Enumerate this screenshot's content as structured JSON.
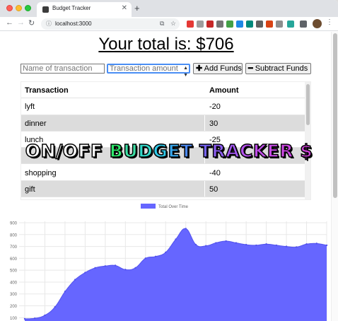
{
  "browser": {
    "tab_title": "Budget Tracker",
    "tab_close": "✕",
    "new_tab": "+",
    "url": "localhost:3000",
    "back_icon": "←",
    "forward_icon": "→",
    "reload_icon": "↻",
    "menu_icon": "⋮"
  },
  "page": {
    "total_text": "Your total is: $706",
    "name_placeholder": "Name of transaction",
    "amount_placeholder": "Transaction amount",
    "add_label": "Add Funds",
    "subtract_label": "Subtract Funds",
    "overlay_title": "ON/OFF BUDGET TRACKER $"
  },
  "table": {
    "headers": [
      "Transaction",
      "Amount"
    ],
    "rows": [
      {
        "name": "lyft",
        "amount": "-20"
      },
      {
        "name": "dinner",
        "amount": "30"
      },
      {
        "name": "lunch",
        "amount": "-25"
      },
      {
        "name": "",
        "amount": ""
      },
      {
        "name": "shopping",
        "amount": "-40"
      },
      {
        "name": "gift",
        "amount": "50"
      },
      {
        "name": "",
        "amount": ""
      }
    ]
  },
  "chart_data": {
    "type": "area",
    "series": [
      {
        "name": "Total Over Time",
        "color": "#6666ff",
        "values": [
          90,
          95,
          120,
          190,
          320,
          420,
          480,
          520,
          535,
          540,
          505,
          520,
          600,
          615,
          650,
          760,
          850,
          715,
          705,
          730,
          745,
          730,
          715,
          710,
          720,
          710,
          700,
          695,
          720,
          725,
          710
        ]
      }
    ],
    "yticks": [
      100,
      200,
      300,
      400,
      500,
      600,
      700,
      800,
      900
    ],
    "ylim": [
      90,
      900
    ],
    "grid": true,
    "legend": "top-center"
  }
}
